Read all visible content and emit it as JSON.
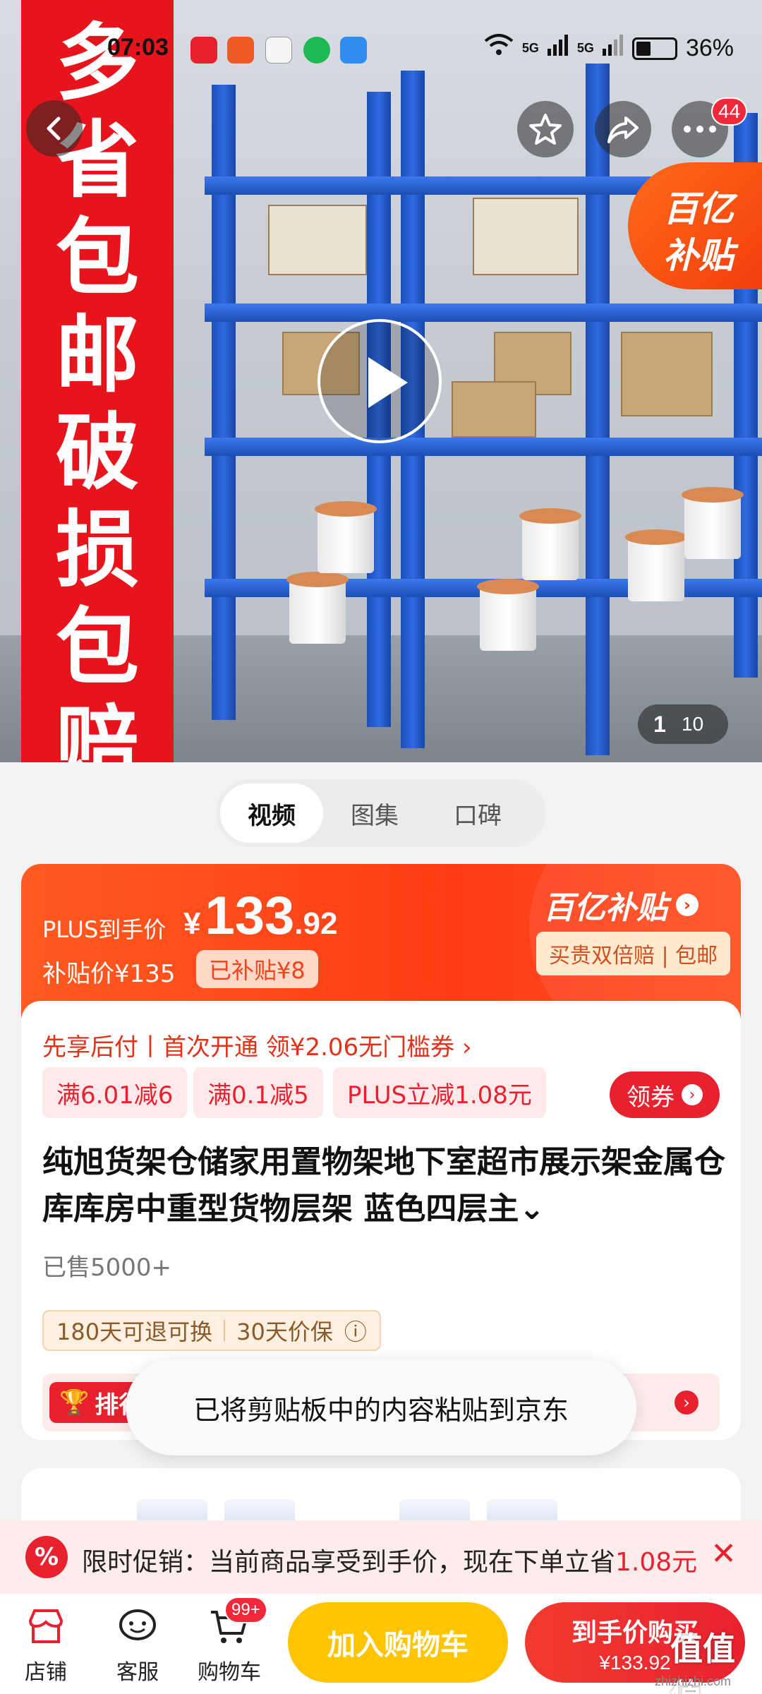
{
  "status_bar": {
    "time": "07:03",
    "signal1": "5G",
    "signal2": "5G",
    "battery": "36%"
  },
  "hero": {
    "banner_text": "多省包邮 破损包赔",
    "corner_badge_line1": "百亿",
    "corner_badge_line2": "补贴",
    "counter_current": "1",
    "counter_total": "10",
    "header_badge": "44"
  },
  "media_tabs": [
    {
      "label": "视频",
      "active": true
    },
    {
      "label": "图集",
      "active": false
    },
    {
      "label": "口碑",
      "active": false
    }
  ],
  "price": {
    "plus_label": "PLUS到手价",
    "currency": "¥",
    "integer": "133",
    "decimal": ".92",
    "subsidy_price": "补贴价¥135",
    "subsidy_amount": "已补贴¥8",
    "program_title": "百亿补贴",
    "guarantee": "买贵双倍赔 | 包邮"
  },
  "product": {
    "first_enjoy": "先享后付丨首次开通 领¥2.06无门槛券 ›",
    "coupons": [
      "满6.01减6",
      "满0.1减5",
      "PLUS立减1.08元"
    ],
    "get_coupon": "领券",
    "title": "纯旭货架仓储家用置物架地下室超市展示架金属仓库库房中重型货物层架 蓝色四层主⌄",
    "sold": "已售5000+",
    "service_return": "180天可退可换",
    "service_price": "30天价保",
    "rank_label": "排行榜"
  },
  "toast": "已将剪贴板中的内容粘贴到京东",
  "promo": {
    "icon": "%",
    "text_prefix": "限时促销：当前商品享受到手价，现在下单立省",
    "text_highlight": "1.08元"
  },
  "bottom_nav": {
    "shop": "店铺",
    "service": "客服",
    "cart": "购物车",
    "cart_badge": "99+",
    "add_to_cart": "加入购物车",
    "buy_now": "到手价购买",
    "buy_price": "¥133.92"
  },
  "watermark": {
    "logo": "值值值",
    "url": "zhizhizhi.com"
  }
}
